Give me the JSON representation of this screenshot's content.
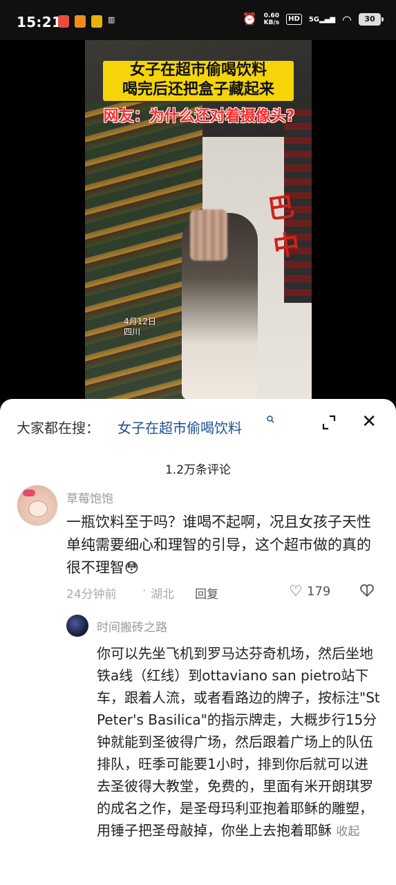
{
  "status": {
    "time": "15:21",
    "app_icon_colors": [
      "#e94b3c",
      "#f28c1f",
      "#e8b20e"
    ],
    "net_speed_value": "0.60",
    "net_speed_unit": "KB/s",
    "hd_label": "HD",
    "signal_label": "5G",
    "battery": "30"
  },
  "video": {
    "title_line1": "女子在超市偷喝饮料",
    "title_line2": "喝完后还把盒子藏起来",
    "subtitle": "网友：为什么还对着摄像头?",
    "date_line1": "4月12日",
    "date_line2": "四川",
    "banner_color": "#f5d50a",
    "subtitle_color": "#ff2a2a"
  },
  "search_bar": {
    "prefix": "大家都在搜：",
    "term": "女子在超市偷喝饮料",
    "search_icon": "search-icon",
    "expand_icon": "expand-icon",
    "close_icon": "close-icon"
  },
  "comments_header": {
    "count_text": "1.2万条评论"
  },
  "comment": {
    "username": "草莓饱饱",
    "text": "一瓶饮料至于吗？谁喝不起啊，况且女孩子天性单纯需要细心和理智的引导，这个超市做的真的很不理智",
    "emoji": "😳",
    "time": "24分钟前",
    "dot": "·",
    "location": "湖北",
    "reply_label": "回复",
    "like_count": "179"
  },
  "reply": {
    "username": "时间搬砖之路",
    "text": "你可以先坐飞机到罗马达芬奇机场，然后坐地铁a线（红线）到ottaviano san pietro站下车，跟着人流，或者看路边的牌子，按标注\"St Peter's Basilica\"的指示牌走，大概步行15分钟就能到圣彼得广场，然后跟着广场上的队伍排队，旺季可能要1小时，排到你后就可以进去圣彼得大教堂，免费的，里面有米开朗琪罗的成名之作，是圣母玛利亚抱着耶稣的雕塑，用锤子把圣母敲掉，你坐上去抱着耶稣",
    "collapse_label": "收起"
  }
}
